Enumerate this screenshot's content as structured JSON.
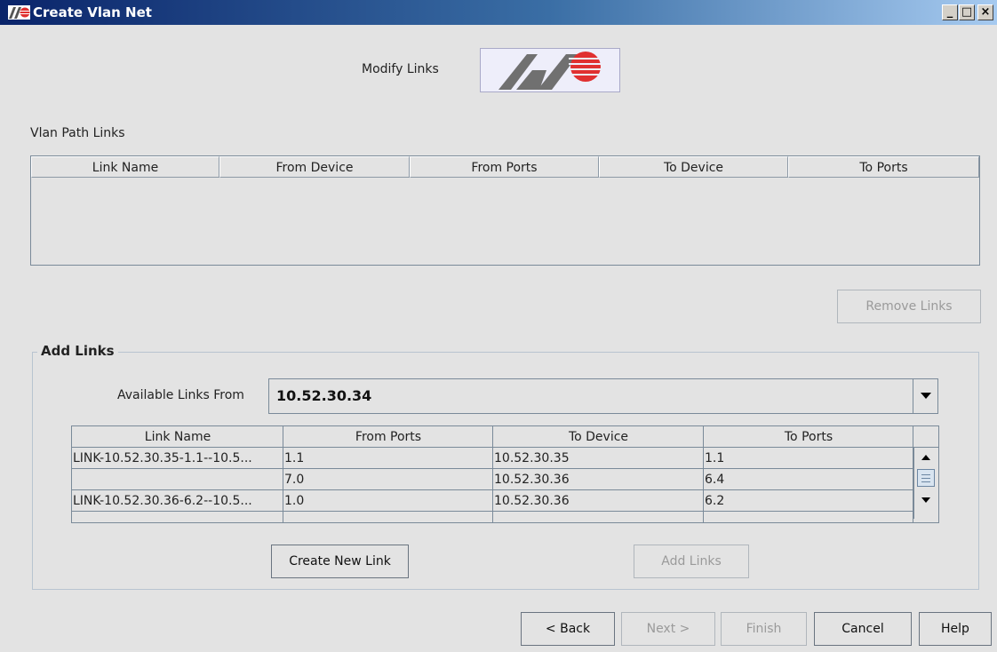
{
  "window": {
    "title": "Create Vlan Net",
    "buttons": {
      "minimize": "_",
      "maximize": "□",
      "close": "×"
    }
  },
  "header": {
    "heading": "Modify Links",
    "logo_icon": "allied-telesis-logo"
  },
  "path_links": {
    "section_label": "Vlan Path Links",
    "columns": [
      "Link Name",
      "From Device",
      "From Ports",
      "To Device",
      "To Ports"
    ],
    "rows": [],
    "remove_button": "Remove Links"
  },
  "add_links": {
    "group_title": "Add Links",
    "available_label": "Available Links From",
    "selected_device": "10.52.30.34",
    "columns": [
      "Link Name",
      "From Ports",
      "To Device",
      "To Ports"
    ],
    "rows": [
      [
        "LINK-10.52.30.35-1.1--10.5...",
        "1.1",
        "10.52.30.35",
        "1.1"
      ],
      [
        "",
        "7.0",
        "10.52.30.36",
        "6.4"
      ],
      [
        "LINK-10.52.30.36-6.2--10.5...",
        "1.0",
        "10.52.30.36",
        "6.2"
      ]
    ],
    "create_button": "Create New Link",
    "add_button": "Add Links"
  },
  "footer": {
    "back": "< Back",
    "next": "Next >",
    "finish": "Finish",
    "cancel": "Cancel",
    "help": "Help"
  },
  "colors": {
    "titlebar_start": "#0a246a",
    "titlebar_end": "#a6caf0",
    "logo_red": "#e03030",
    "logo_gray": "#707070"
  }
}
